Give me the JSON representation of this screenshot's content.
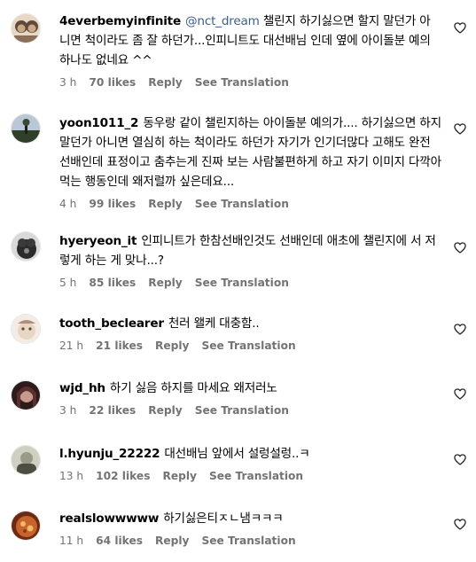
{
  "comments": [
    {
      "username": "4everbemyinfinite",
      "mention": "@nct_dream",
      "text": "챌린지 하기싫으면 할지 말던가 아 니면 척이라도 좀 잘 하던가...인피니트도 대선배님 인데 옆에 아이돌분 예의 하나도 없네요 ^^",
      "time": "3 h",
      "likes": "70 likes",
      "reply": "Reply",
      "translation": "See Translation",
      "avatar_colors": [
        "#c9a98a",
        "#5d4a3a",
        "#e8d7c4"
      ]
    },
    {
      "username": "yoon1011_2",
      "mention": "",
      "text": "동우랑 같이 챌린지하는 아이돌분 예의가.... 하기싫으면 하지말던가 아니면 열심히 하는 척이라도 하던가 자기가 인기더많다 고해도 완전 선배인데 표정이고 춤추는게 진짜 보는 사람불편하게 하고 자기 이미지 다깍아먹는 행동인데 왜저럴까 싶은데요...",
      "time": "4 h",
      "likes": "99 likes",
      "reply": "Reply",
      "translation": "See Translation",
      "avatar_colors": [
        "#6a86a8",
        "#2f3f2a",
        "#b9c7d6"
      ]
    },
    {
      "username": "hyeryeon_it",
      "mention": "",
      "text": "인피니트가 한참선배인것도 선배인데 애초에 챌린지에 서 저렇게 하는 게 맞나...?",
      "time": "5 h",
      "likes": "85 likes",
      "reply": "Reply",
      "translation": "See Translation",
      "avatar_colors": [
        "#2b2b2b",
        "#888888",
        "#d9d9d9"
      ]
    },
    {
      "username": "tooth_beclearer",
      "mention": "",
      "text": "천러 왤케 대충함..",
      "time": "21 h",
      "likes": "21 likes",
      "reply": "Reply",
      "translation": "See Translation",
      "avatar_colors": [
        "#e8d5c4",
        "#b08f7a",
        "#f4ece4"
      ]
    },
    {
      "username": "wjd_hh",
      "mention": "",
      "text": "하기 싫음 하지를 마세요 왜저러노",
      "time": "3 h",
      "likes": "22 likes",
      "reply": "Reply",
      "translation": "See Translation",
      "avatar_colors": [
        "#5a2f2f",
        "#c79a8c",
        "#2d1b1b"
      ]
    },
    {
      "username": "l.hyunju_22222",
      "mention": "",
      "text": "대선배님 앞에서 설렁설렁..ㅋ",
      "time": "13 h",
      "likes": "102 likes",
      "reply": "Reply",
      "translation": "See Translation",
      "avatar_colors": [
        "#9a9a8a",
        "#4d4d44",
        "#cfcfc2"
      ]
    },
    {
      "username": "realslowwwww",
      "mention": "",
      "text": "하기싫은티ㅈㄴ냄ㅋㅋㅋ",
      "time": "11 h",
      "likes": "64 likes",
      "reply": "Reply",
      "translation": "See Translation",
      "avatar_colors": [
        "#c8642b",
        "#f0b86a",
        "#6b2a12"
      ]
    }
  ]
}
